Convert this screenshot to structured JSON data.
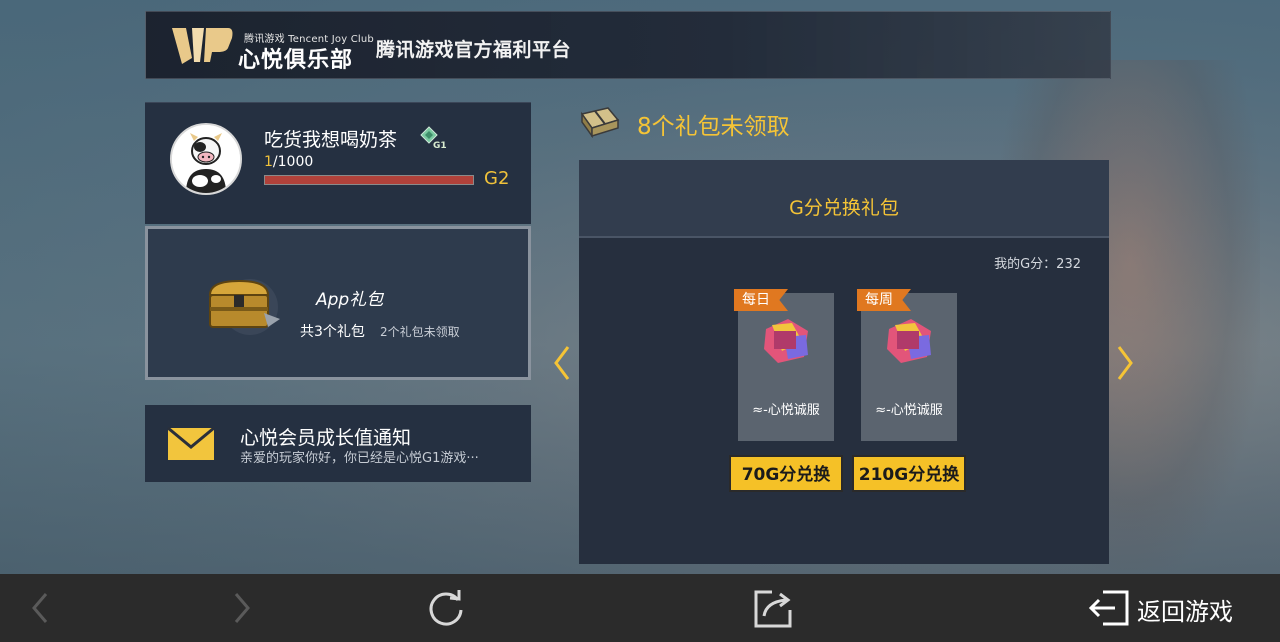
{
  "header": {
    "logo_sub": "腾讯游戏 Tencent Joy Club",
    "logo_main": "心悦俱乐部",
    "tagline": "腾讯游戏官方福利平台"
  },
  "user": {
    "name": "吃货我想喝奶茶",
    "rank_badge": "G1",
    "progress_current": "1",
    "progress_total": "/1000",
    "progress_fraction": 0.001,
    "next_level": "G2"
  },
  "app_gift": {
    "title": "App礼包",
    "count_text": "共3个礼包",
    "unclaimed_text": "2个礼包未领取"
  },
  "notice": {
    "title": "心悦会员成长值通知",
    "body": "亲爱的玩家你好，你已经是心悦G1游戏···"
  },
  "gifts": {
    "unclaimed_header": "8个礼包未领取",
    "panel_title": "G分兑换礼包",
    "my_score": "我的G分：232",
    "packages": [
      {
        "tag": "每日",
        "name": "≈-心悦诚服",
        "button": "70G分兑换"
      },
      {
        "tag": "每周",
        "name": "≈-心悦诚服",
        "button": "210G分兑换"
      }
    ]
  },
  "bottom_bar": {
    "back_label": "返回游戏"
  },
  "colors": {
    "accent_gold": "#f5c436",
    "tag_orange": "#e07820",
    "progress_red": "#b0413a",
    "bar_bg": "#2b2b2b"
  }
}
